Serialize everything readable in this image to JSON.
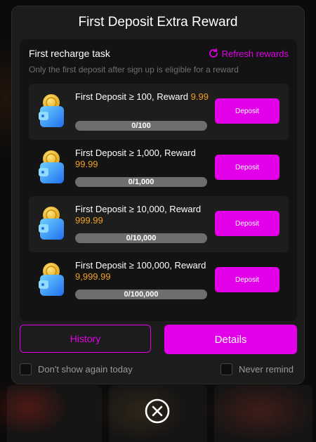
{
  "modal": {
    "title": "First Deposit Extra Reward"
  },
  "task": {
    "title": "First recharge task",
    "refresh_label": "Refresh rewards",
    "subtitle": "Only the first deposit after sign up is eligible for a reward",
    "items": [
      {
        "label": "First Deposit ≥ 100, Reward ",
        "reward": "9.99",
        "progress_text": "0/100",
        "progress_fraction": 0,
        "button_label": "Deposit"
      },
      {
        "label": "First Deposit ≥ 1,000, Reward ",
        "reward": "99.99",
        "progress_text": "0/1,000",
        "progress_fraction": 0,
        "button_label": "Deposit"
      },
      {
        "label": "First Deposit ≥ 10,000, Reward ",
        "reward": "999.99",
        "progress_text": "0/10,000",
        "progress_fraction": 0,
        "button_label": "Deposit"
      },
      {
        "label": "First Deposit ≥ 100,000, Reward ",
        "reward": "9,999.99",
        "progress_text": "0/100,000",
        "progress_fraction": 0,
        "button_label": "Deposit"
      }
    ]
  },
  "actions": {
    "history_label": "History",
    "details_label": "Details"
  },
  "options": {
    "dont_show_today": "Don't show again today",
    "never_remind": "Never remind"
  },
  "icons": {
    "refresh": "refresh-icon",
    "wallet": "wallet-coin-icon",
    "close": "close-circle-icon"
  },
  "colors": {
    "accent": "#e100e8",
    "reward": "#f0a020",
    "modal_bg": "#1c1c1c",
    "card_bg": "#131313",
    "progress_track": "#6e6e6e"
  }
}
